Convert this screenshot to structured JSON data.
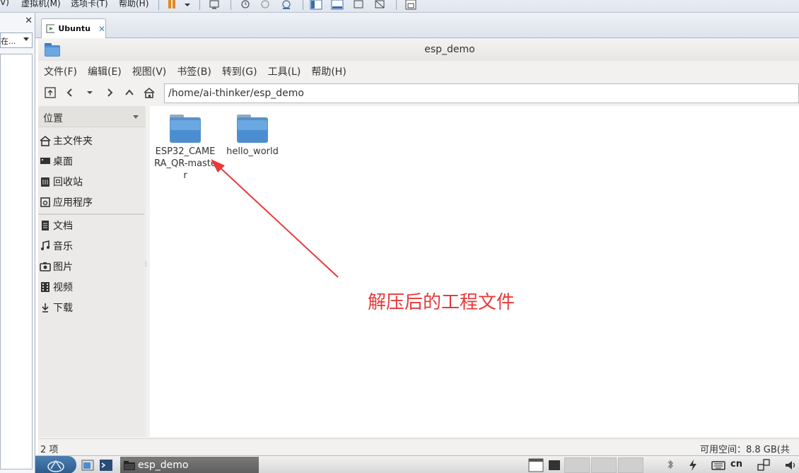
{
  "vmware": {
    "menu": [
      "V)",
      "虚拟机(M)",
      "选项卡(T)",
      "帮助(H)"
    ],
    "left_panel": {
      "search_text": "在..."
    },
    "tab": {
      "label": "Ubuntu"
    }
  },
  "window": {
    "title": "esp_demo"
  },
  "menubar": [
    {
      "label": "文件(F)"
    },
    {
      "label": "编辑(E)"
    },
    {
      "label": "视图(V)"
    },
    {
      "label": "书签(B)"
    },
    {
      "label": "转到(G)"
    },
    {
      "label": "工具(L)"
    },
    {
      "label": "帮助(H)"
    }
  ],
  "location": {
    "path": "/home/ai-thinker/esp_demo"
  },
  "sidebar": {
    "header": "位置",
    "items": [
      {
        "label": "主文件夹",
        "icon": "home-icon"
      },
      {
        "label": "桌面",
        "icon": "desktop-icon"
      },
      {
        "label": "回收站",
        "icon": "trash-icon"
      },
      {
        "label": "应用程序",
        "icon": "applications-icon"
      },
      {
        "label": "文档",
        "icon": "documents-icon"
      },
      {
        "label": "音乐",
        "icon": "music-icon"
      },
      {
        "label": "图片",
        "icon": "pictures-icon"
      },
      {
        "label": "视频",
        "icon": "videos-icon"
      },
      {
        "label": "下载",
        "icon": "downloads-icon"
      }
    ]
  },
  "files": [
    {
      "name": "ESP32_CAMERA_QR-master",
      "icon": "folder-icon"
    },
    {
      "name": "hello_world",
      "icon": "folder-icon"
    }
  ],
  "status": {
    "count": "2 项",
    "free_space": "可用空间：8.8 GB(共"
  },
  "annotation": {
    "text": "解压后的工程文件",
    "color": "#e8393a"
  },
  "taskbar": {
    "window_label": "esp_demo",
    "tray_input": "cn"
  },
  "colors": {
    "folder_blue": "#4a8ed1",
    "accent_red": "#e8393a"
  }
}
